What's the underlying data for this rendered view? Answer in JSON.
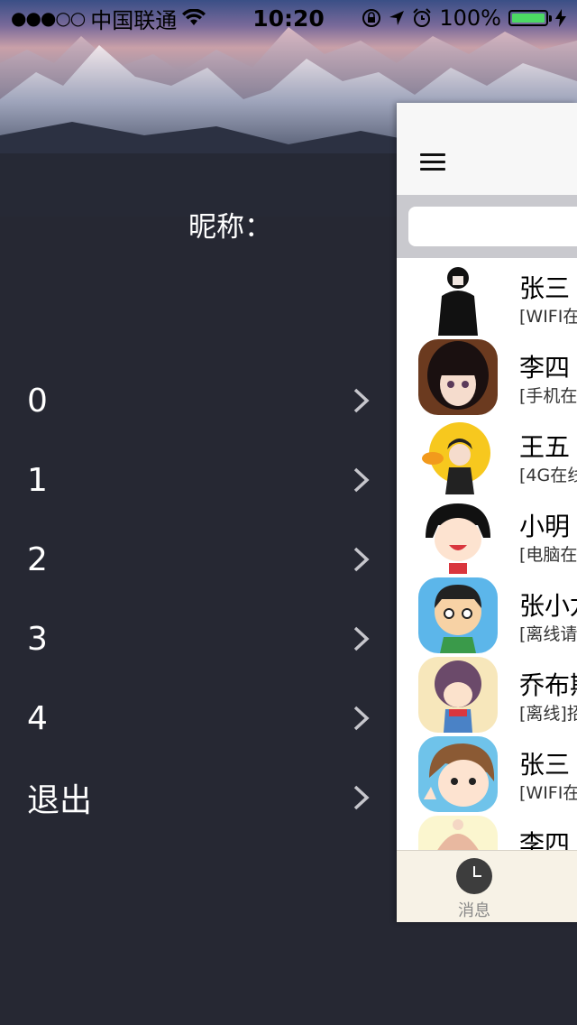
{
  "status_bar": {
    "signal_dots": "●●●○○",
    "carrier": "中国联通",
    "time": "10:20",
    "battery_text": "100%",
    "battery_level": 1.0,
    "battery_color": "#4cd964"
  },
  "drawer": {
    "nickname_label": "昵称：",
    "menu_items": [
      {
        "label": "0"
      },
      {
        "label": "1"
      },
      {
        "label": "2"
      },
      {
        "label": "3"
      },
      {
        "label": "4"
      },
      {
        "label": "退出"
      }
    ]
  },
  "search": {
    "placeholder": ""
  },
  "contacts": [
    {
      "name": "张三",
      "status": "[WIFI在",
      "avatar": "avatar-black-hoodie"
    },
    {
      "name": "李四",
      "status": "[手机在",
      "avatar": "avatar-anime-girl"
    },
    {
      "name": "王五",
      "status": "[4G在线",
      "avatar": "avatar-yellow-duck"
    },
    {
      "name": "小明",
      "status": "[电脑在",
      "avatar": "avatar-cartoon-girl"
    },
    {
      "name": "张小龙",
      "status": "[离线请",
      "avatar": "avatar-cartoon-boy"
    },
    {
      "name": "乔布斯",
      "status": "[离线]招",
      "avatar": "avatar-curly-girl"
    },
    {
      "name": "张三",
      "status": "[WIFI在",
      "avatar": "avatar-peace-girl"
    },
    {
      "name": "李四",
      "status": "",
      "avatar": "avatar-hat-girl"
    }
  ],
  "tabbar": {
    "tab_label": "消息"
  },
  "colors": {
    "drawer_bg": "#262833",
    "panel_bg": "#f6f6f6",
    "tabbar_bg": "#f7f2e6"
  }
}
